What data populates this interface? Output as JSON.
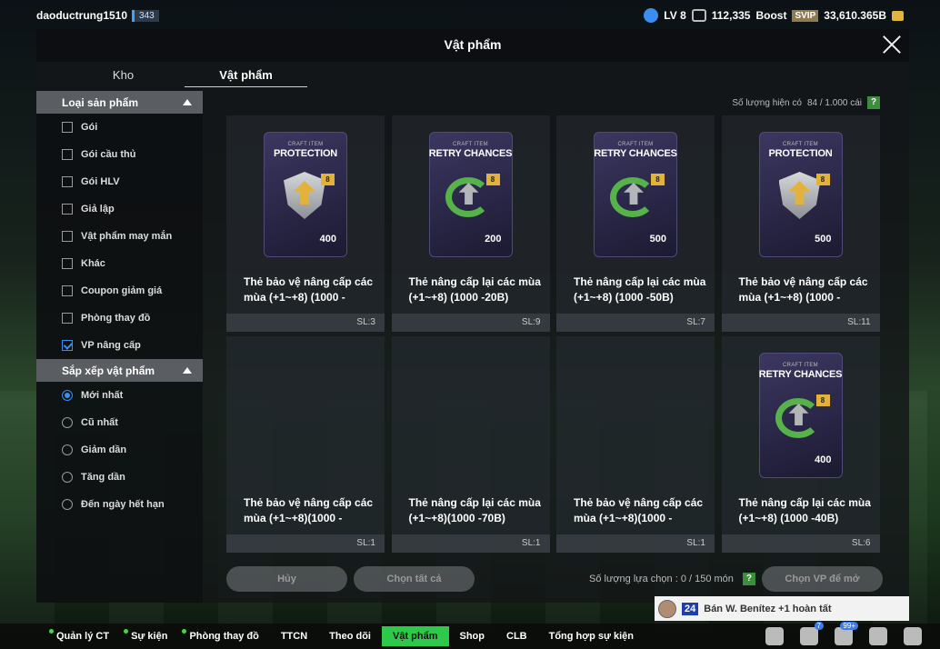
{
  "user": {
    "name": "daoductrung1510",
    "level_badge": "343",
    "lv": "LV 8",
    "coins": "112,335",
    "boost": "Boost",
    "svip": "SVIP",
    "balance": "33,610.365B"
  },
  "modal": {
    "title": "Vật phẩm",
    "tabs": [
      "Kho",
      "Vật phẩm"
    ],
    "active_tab": 1
  },
  "sidebar": {
    "section1": "Loại sản phẩm",
    "filters": [
      {
        "label": "Gói",
        "checked": false
      },
      {
        "label": "Gói cầu thủ",
        "checked": false
      },
      {
        "label": "Gói HLV",
        "checked": false
      },
      {
        "label": "Giả lập",
        "checked": false
      },
      {
        "label": "Vật phẩm may mắn",
        "checked": false
      },
      {
        "label": "Khác",
        "checked": false
      },
      {
        "label": "Coupon giảm giá",
        "checked": false
      },
      {
        "label": "Phòng thay đồ",
        "checked": false
      },
      {
        "label": "VP nâng cấp",
        "checked": true
      }
    ],
    "section2": "Sắp xếp vật phẩm",
    "sorts": [
      {
        "label": "Mới nhất",
        "selected": true
      },
      {
        "label": "Cũ nhất",
        "selected": false
      },
      {
        "label": "Giảm dần",
        "selected": false
      },
      {
        "label": "Tăng dần",
        "selected": false
      },
      {
        "label": "Đến ngày hết hạn",
        "selected": false
      }
    ]
  },
  "count": {
    "label": "Số lượng hiện có",
    "value": "84 / 1.000 cái",
    "help": "?"
  },
  "items": [
    {
      "tag": "CRAFT ITEM",
      "card": "PROTECTION",
      "kind": "protection",
      "lvl": "8",
      "value": "400",
      "title": "Thẻ bảo vệ nâng cấp các mùa (+1~+8) (1000 -",
      "qty": "SL:3",
      "image": true
    },
    {
      "tag": "CRAFT ITEM",
      "card": "RETRY CHANCES",
      "kind": "retry",
      "lvl": "8",
      "value": "200",
      "title": "Thẻ nâng cấp lại các mùa (+1~+8) (1000 -20B)",
      "qty": "SL:9",
      "image": true
    },
    {
      "tag": "CRAFT ITEM",
      "card": "RETRY CHANCES",
      "kind": "retry",
      "lvl": "8",
      "value": "500",
      "title": "Thẻ nâng cấp lại các mùa (+1~+8) (1000 -50B)",
      "qty": "SL:7",
      "image": true
    },
    {
      "tag": "CRAFT ITEM",
      "card": "PROTECTION",
      "kind": "protection",
      "lvl": "8",
      "value": "500",
      "title": "Thẻ bảo vệ nâng cấp các mùa (+1~+8) (1000 -",
      "qty": "SL:11",
      "image": true
    },
    {
      "title": "Thẻ bảo vệ nâng cấp các mùa (+1~+8)(1000 -",
      "qty": "SL:1",
      "image": false
    },
    {
      "title": "Thẻ nâng cấp lại các mùa (+1~+8)(1000 -70B)",
      "qty": "SL:1",
      "image": false
    },
    {
      "title": "Thẻ bảo vệ nâng cấp các mùa (+1~+8)(1000 -",
      "qty": "SL:1",
      "image": false
    },
    {
      "tag": "CRAFT ITEM",
      "card": "RETRY CHANCES",
      "kind": "retry",
      "lvl": "8",
      "value": "400",
      "title": "Thẻ nâng cấp lại các mùa (+1~+8) (1000 -40B)",
      "qty": "SL:6",
      "image": true
    }
  ],
  "buttons": {
    "cancel": "Hủy",
    "select_all": "Chọn tất cả",
    "selected_count": "Số lượng lựa chọn : 0 / 150 món",
    "help": "?",
    "choose": "Chọn VP để mở"
  },
  "toast": {
    "ovr": "24",
    "text": "Bán W. Benítez +1 hoàn tất"
  },
  "nav": {
    "items": [
      {
        "label": "Quản lý CT",
        "dot": true
      },
      {
        "label": "Sự kiện",
        "dot": true
      },
      {
        "label": "Phòng thay đồ",
        "dot": true
      },
      {
        "label": "TTCN",
        "dot": false
      },
      {
        "label": "Theo dõi",
        "dot": false
      },
      {
        "label": "Vật phẩm",
        "dot": false,
        "active": true
      },
      {
        "label": "Shop",
        "dot": false
      },
      {
        "label": "CLB",
        "dot": false
      },
      {
        "label": "Tổng hợp sự kiện",
        "dot": false
      }
    ],
    "badge_home": "7",
    "badge_bell": "99+"
  }
}
